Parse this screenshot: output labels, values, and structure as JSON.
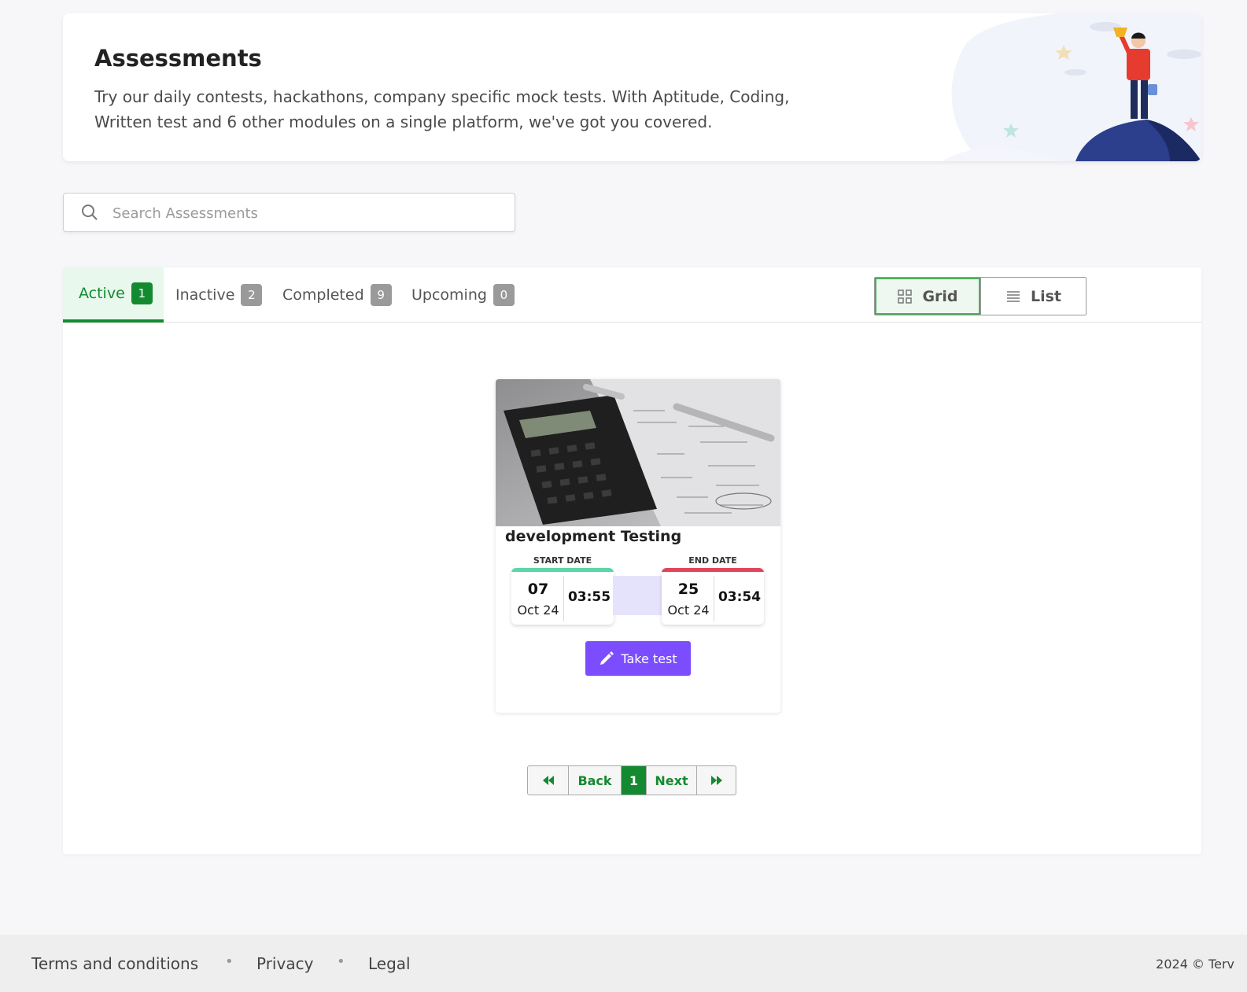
{
  "header": {
    "title": "Assessments",
    "description": "Try our daily contests, hackathons, company specific mock tests. With Aptitude, Coding, Written test and 6 other modules on a single platform, we've got you covered."
  },
  "search": {
    "placeholder": "Search Assessments",
    "value": ""
  },
  "tabs": [
    {
      "label": "Active",
      "count": "1",
      "active": true
    },
    {
      "label": "Inactive",
      "count": "2",
      "active": false
    },
    {
      "label": "Completed",
      "count": "9",
      "active": false
    },
    {
      "label": "Upcoming",
      "count": "0",
      "active": false
    }
  ],
  "view_toggle": {
    "grid_label": "Grid",
    "list_label": "List",
    "selected": "Grid"
  },
  "card": {
    "title": "development Testing",
    "start": {
      "label": "START DATE",
      "day": "07",
      "month": "Oct 24",
      "time": "03:55",
      "color": "#5dd6a8"
    },
    "end": {
      "label": "END DATE",
      "day": "25",
      "month": "Oct 24",
      "time": "03:54",
      "color": "#e0465c"
    },
    "action_label": "Take test"
  },
  "pagination": {
    "back_label": "Back",
    "current_page": "1",
    "next_label": "Next"
  },
  "footer": {
    "links": [
      "Terms and conditions",
      "Privacy",
      "Legal"
    ],
    "copyright": "2024 © Terv"
  },
  "colors": {
    "accent_green": "#138a30",
    "action_purple": "#7b4dff"
  }
}
